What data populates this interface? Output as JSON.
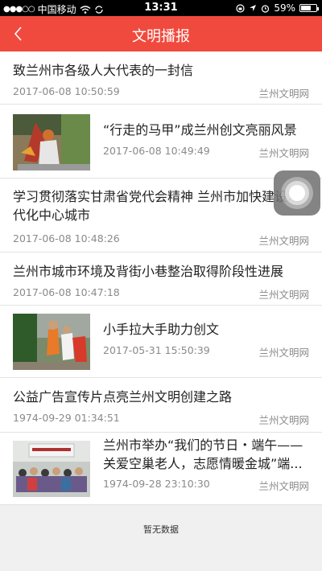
{
  "status_bar": {
    "carrier": "中国移动",
    "time": "13:31",
    "battery": "59%",
    "icons": [
      "signal-dots-icon",
      "wifi-icon",
      "sync-icon",
      "lock-rotation-icon",
      "location-arrow-icon",
      "alarm-icon",
      "battery-icon"
    ]
  },
  "nav": {
    "title": "文明播报",
    "back_icon": "chevron-left-icon"
  },
  "news": [
    {
      "title": "致兰州市各级人大代表的一封信",
      "date": "2017-06-08 10:50:59",
      "source": "兰州文明网"
    },
    {
      "title": "“行走的马甲”成兰州创文亮丽风景",
      "date": "2017-06-08 10:49:49",
      "source": "兰州文明网"
    },
    {
      "title_line1": "学习贯彻落实甘肃省党代会精神 兰州市加快建设现",
      "title_line2": "代化中心城市",
      "date": "2017-06-08 10:48:26",
      "source": "兰州文明网"
    },
    {
      "title": "兰州市城市环境及背街小巷整治取得阶段性进展",
      "date": "2017-06-08 10:47:18",
      "source": "兰州文明网"
    },
    {
      "title": "小手拉大手助力创文",
      "date": "2017-05-31 15:50:39",
      "source": "兰州文明网"
    },
    {
      "title": "公益广告宣传片点亮兰州文明创建之路",
      "date": "1974-09-29 01:34:51",
      "source": "兰州文明网"
    },
    {
      "title_line1": "兰州市举办“我们的节日・端午——",
      "title_line2": "关爱空巢老人，志愿情暖金城”端...",
      "date": "1974-09-28 23:10:30",
      "source": "兰州文明网"
    }
  ],
  "footer": {
    "no_data": "暂无数据"
  }
}
